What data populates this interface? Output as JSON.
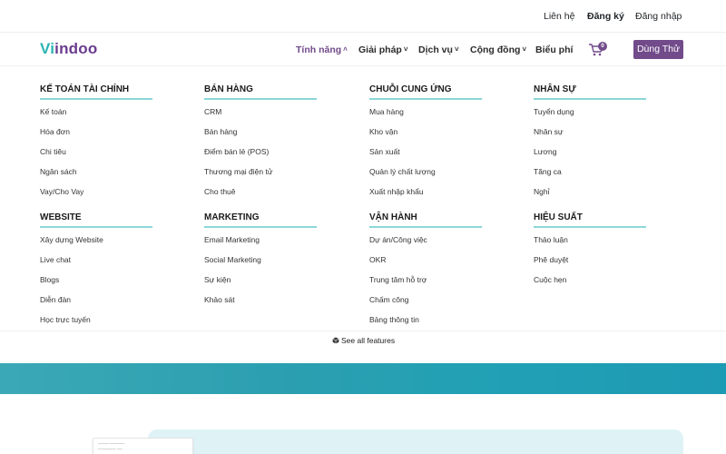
{
  "topbar": {
    "contact": "Liên hệ",
    "register": "Đăng ký",
    "login": "Đăng nhập"
  },
  "navbar": {
    "logo": {
      "part1": "V",
      "part2": "i",
      "part3": "indoo"
    },
    "items": [
      {
        "label": "Tính năng",
        "active": true,
        "chevron": "up"
      },
      {
        "label": "Giải pháp",
        "chevron": "down"
      },
      {
        "label": "Dịch vụ",
        "chevron": "down"
      },
      {
        "label": "Cộng đồng",
        "chevron": "down"
      },
      {
        "label": "Biểu phí"
      }
    ],
    "cart_count": "0",
    "trial_button": "Dùng Thử"
  },
  "menu": {
    "sections": [
      {
        "title": "KẾ TOÁN TÀI CHÍNH",
        "items": [
          "Kế toán",
          "Hóa đơn",
          "Chi tiêu",
          "Ngân sách",
          "Vay/Cho Vay"
        ]
      },
      {
        "title": "BÁN HÀNG",
        "items": [
          "CRM",
          "Bán hàng",
          "Điểm bán lẻ (POS)",
          "Thương mại điện tử",
          "Cho thuê"
        ]
      },
      {
        "title": "CHUỖI CUNG ỨNG",
        "items": [
          "Mua hàng",
          "Kho vận",
          "Sản xuất",
          "Quản lý chất lượng",
          "Xuất nhập khẩu"
        ]
      },
      {
        "title": "NHÂN SỰ",
        "items": [
          "Tuyển dụng",
          "Nhân sự",
          "Lương",
          "Tăng ca",
          "Nghỉ"
        ]
      },
      {
        "title": "WEBSITE",
        "items": [
          "Xây dựng Website",
          "Live chat",
          "Blogs",
          "Diễn đàn",
          "Học trực tuyến"
        ]
      },
      {
        "title": "MARKETING",
        "items": [
          "Email Marketing",
          "Social Marketing",
          "Sự kiện",
          "Khảo sát"
        ]
      },
      {
        "title": "VẬN HÀNH",
        "items": [
          "Dự án/Công việc",
          "OKR",
          "Trung tâm hỗ trợ",
          "Chấm công",
          "Bảng thông tin"
        ]
      },
      {
        "title": "HIỆU SUẤT",
        "items": [
          "Thảo luận",
          "Phê duyệt",
          "Cuộc hẹn"
        ]
      }
    ],
    "see_all": "See all features"
  },
  "colors": {
    "brand_purple": "#714b8a",
    "brand_teal": "#2ab3b1",
    "underline": "#8ad7d9"
  }
}
